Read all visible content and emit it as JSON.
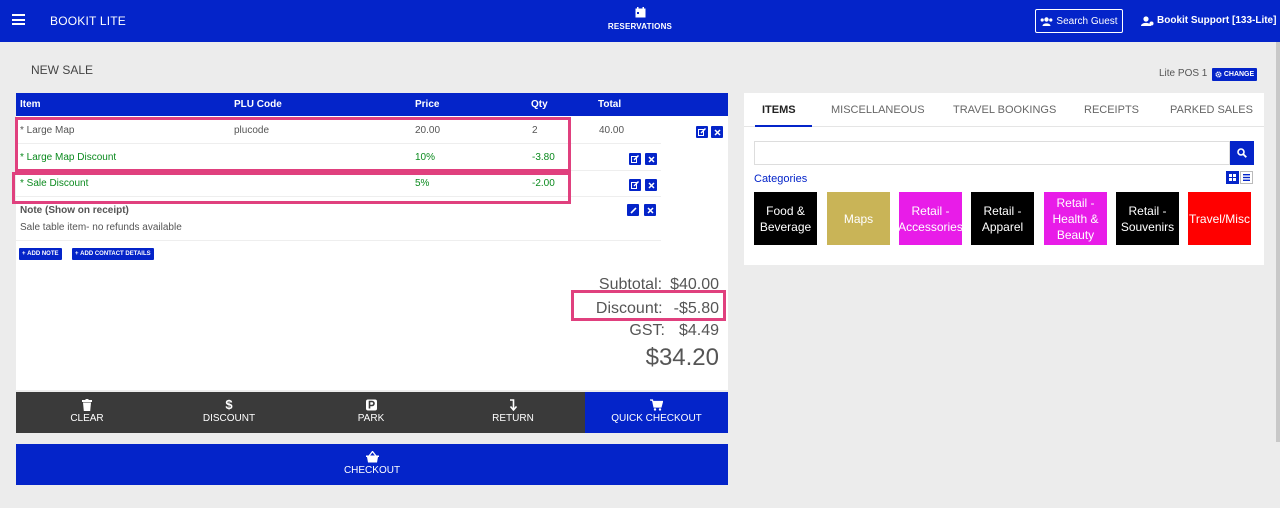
{
  "app": {
    "title": "BOOKIT LITE",
    "center_nav_label": "RESERVATIONS",
    "search_guest_label": "Search Guest",
    "user_label": "Bookit Support [133-Lite]"
  },
  "page": {
    "title": "NEW SALE",
    "pos_label": "Lite POS 1",
    "change_label": "CHANGE"
  },
  "sale_table": {
    "headers": [
      "Item",
      "PLU Code",
      "Price",
      "Qty",
      "Total"
    ],
    "rows": [
      {
        "item": "* Large Map",
        "plu": "plucode",
        "price": "20.00",
        "qty": "2",
        "total": "40.00"
      },
      {
        "item": "* Large Map Discount",
        "plu": "",
        "price": "10%",
        "qty": "-3.80",
        "total": ""
      },
      {
        "item": "* Sale Discount",
        "plu": "",
        "price": "5%",
        "qty": "-2.00",
        "total": ""
      }
    ],
    "note_title": "Note (Show on receipt)",
    "note_text": "Sale table item- no refunds available",
    "add_note_label": "ADD NOTE",
    "add_contact_label": "ADD CONTACT DETAILS"
  },
  "totals": {
    "subtotal_label": "Subtotal:",
    "subtotal_value": "$40.00",
    "discount_label": "Discount:",
    "discount_value": "-$5.80",
    "gst_label": "GST:",
    "gst_value": "$4.49",
    "grand_total": "$34.20"
  },
  "actions": {
    "clear": "CLEAR",
    "discount": "DISCOUNT",
    "park": "PARK",
    "return": "RETURN",
    "quick_checkout": "QUICK CHECKOUT",
    "checkout": "CHECKOUT"
  },
  "catalog": {
    "tabs": [
      "ITEMS",
      "MISCELLANEOUS",
      "TRAVEL BOOKINGS",
      "RECEIPTS",
      "PARKED SALES"
    ],
    "active_tab": "ITEMS",
    "search_value": "",
    "categories_label": "Categories",
    "categories": [
      {
        "name": "Food & Beverage",
        "color": "#000000"
      },
      {
        "name": "Maps",
        "color": "#c9b457"
      },
      {
        "name": "Retail - Accessories",
        "color": "#e81ce8"
      },
      {
        "name": "Retail - Apparel",
        "color": "#000000"
      },
      {
        "name": "Retail - Health & Beauty",
        "color": "#e81ce8"
      },
      {
        "name": "Retail - Souvenirs",
        "color": "#000000"
      },
      {
        "name": "Travel/Misc",
        "color": "#ff0000"
      }
    ]
  },
  "colors": {
    "primary": "#0424c9",
    "highlight": "#e0407e",
    "discount_text": "#0b8a1e"
  }
}
